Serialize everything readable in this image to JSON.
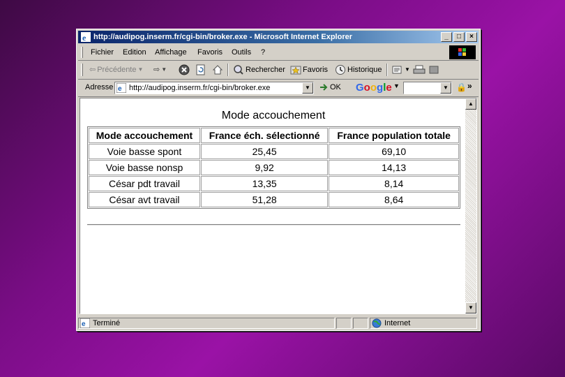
{
  "window": {
    "title": "http://audipog.inserm.fr/cgi-bin/broker.exe - Microsoft Internet Explorer",
    "minimize": "_",
    "maximize": "□",
    "close": "×"
  },
  "menu": [
    "Fichier",
    "Edition",
    "Affichage",
    "Favoris",
    "Outils",
    "?"
  ],
  "toolbar": {
    "back": "Précédente",
    "search": "Rechercher",
    "favorites": "Favoris",
    "history": "Historique"
  },
  "address": {
    "label": "Adresse",
    "url": "http://audipog.inserm.fr/cgi-bin/broker.exe",
    "go": "OK",
    "google": "Google"
  },
  "page": {
    "title": "Mode accouchement",
    "table": {
      "headers": [
        "Mode accouchement",
        "France éch. sélectionné",
        "France population totale"
      ],
      "rows": [
        [
          "Voie basse spont",
          "25,45",
          "69,10"
        ],
        [
          "Voie basse nonsp",
          "9,92",
          "14,13"
        ],
        [
          "César pdt travail",
          "13,35",
          "8,14"
        ],
        [
          "César avt travail",
          "51,28",
          "8,64"
        ]
      ]
    }
  },
  "status": {
    "text": "Terminé",
    "zone": "Internet"
  }
}
